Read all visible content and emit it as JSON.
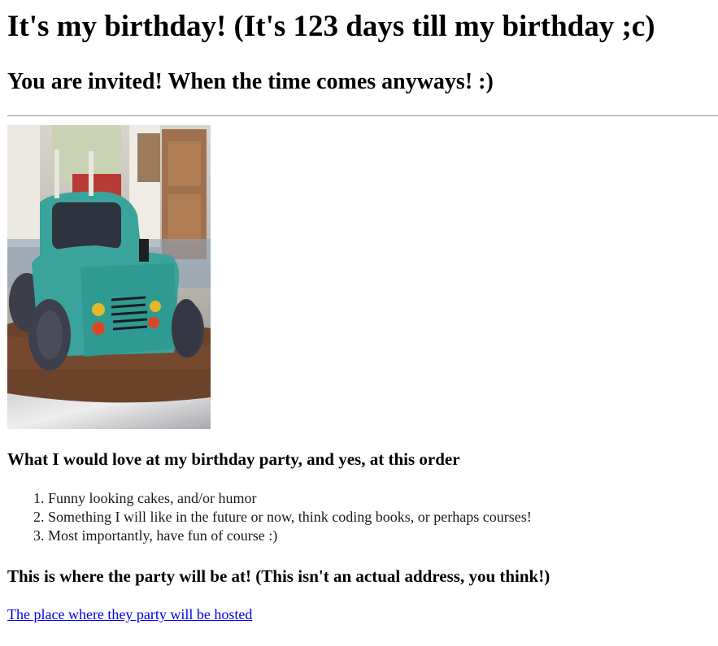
{
  "header": {
    "title": "It's my birthday! (It's 123 days till my birthday ;c)",
    "subtitle": "You are invited! When the time comes anyways! :)"
  },
  "wishes": {
    "heading": "What I would love at my birthday party, and yes, at this order",
    "items": [
      "Funny looking cakes, and/or humor",
      "Something I will like in the future or now, think coding books, or perhaps courses!",
      "Most importantly, have fun of course :)"
    ]
  },
  "party": {
    "heading": "This is where the party will be at! (This isn't an actual address, you think!)",
    "link_text": "The place where they party will be hosted"
  },
  "colors": {
    "link": "#0000ee",
    "divider": "#9a9a9a",
    "cake_frosting": "#3aa39b"
  }
}
